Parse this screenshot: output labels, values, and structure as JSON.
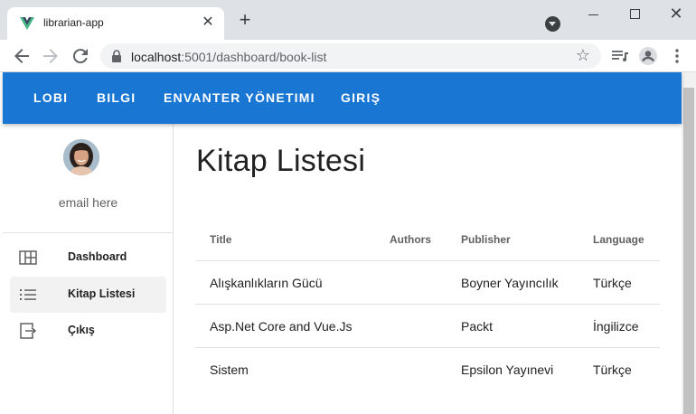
{
  "browser": {
    "tab_title": "librarian-app",
    "new_tab_symbol": "+",
    "close_symbol": "✕",
    "url_host": "localhost",
    "url_rest": ":5001/dashboard/book-list"
  },
  "appbar": {
    "links": [
      "LOBI",
      "BILGI",
      "ENVANTER YÖNETIMI",
      "GIRIŞ"
    ]
  },
  "sidebar": {
    "email": "email here",
    "items": [
      {
        "label": "Dashboard",
        "icon": "dashboard-icon"
      },
      {
        "label": "Kitap Listesi",
        "icon": "list-icon"
      },
      {
        "label": "Çıkış",
        "icon": "exit-icon"
      }
    ]
  },
  "main": {
    "title": "Kitap Listesi",
    "table": {
      "headers": [
        "Title",
        "Authors",
        "Publisher",
        "Language"
      ],
      "rows": [
        [
          "Alışkanlıkların Gücü",
          "",
          "Boyner Yayıncılık",
          "Türkçe"
        ],
        [
          "Asp.Net Core and Vue.Js",
          "",
          "Packt",
          "İngilizce"
        ],
        [
          "Sistem",
          "",
          "Epsilon Yayınevi",
          "Türkçe"
        ]
      ]
    }
  },
  "colors": {
    "appbar": "#1976d2",
    "vue_green": "#41b883",
    "vue_dark": "#35495e"
  }
}
